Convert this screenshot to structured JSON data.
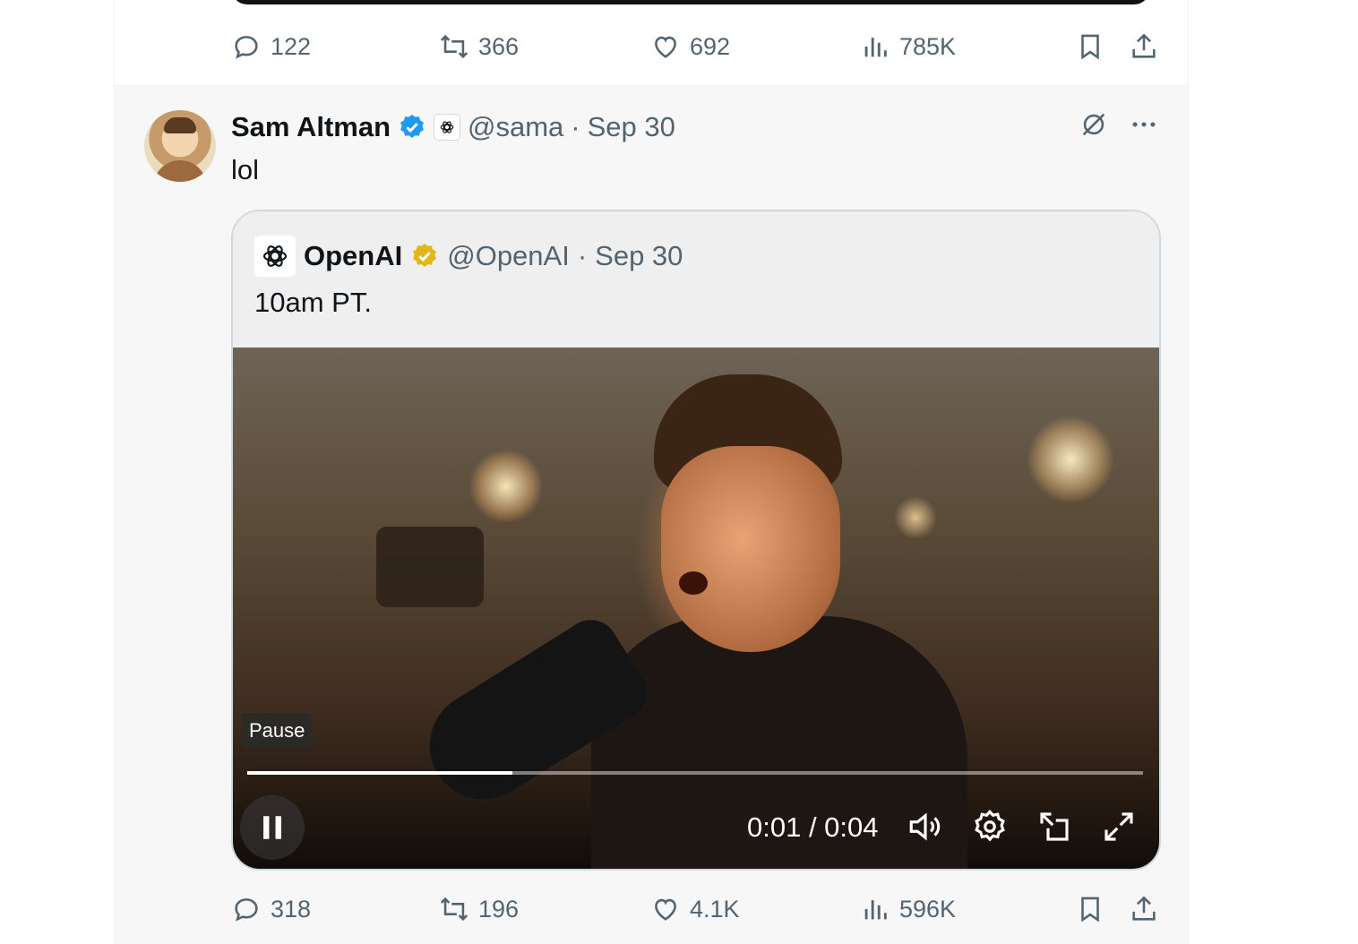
{
  "prev_tweet": {
    "actions": {
      "replies": "122",
      "retweets": "366",
      "likes": "692",
      "views": "785K"
    }
  },
  "tweet": {
    "author_name": "Sam Altman",
    "handle": "@sama",
    "separator": "·",
    "date": "Sep 30",
    "text": "lol",
    "quote": {
      "author_name": "OpenAI",
      "handle": "@OpenAI",
      "separator": "·",
      "date": "Sep 30",
      "text": "10am PT.",
      "video": {
        "tooltip": "Pause",
        "time": "0:01 / 0:04",
        "progress": 0.296
      }
    },
    "actions": {
      "replies": "318",
      "retweets": "196",
      "likes": "4.1K",
      "views": "596K"
    }
  },
  "colors": {
    "verified_blue": "#1d9bf0",
    "verified_gold": "#e2b719",
    "link": "#1d9bf0"
  }
}
